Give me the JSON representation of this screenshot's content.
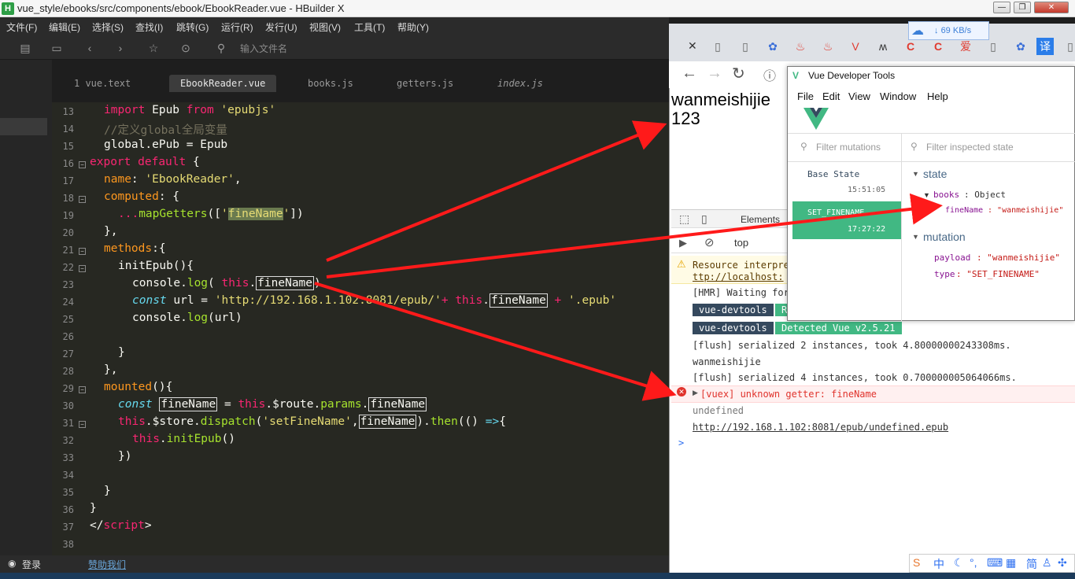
{
  "window": {
    "title": "vue_style/ebooks/src/components/ebook/EbookReader.vue - HBuilder X",
    "app_icon": "H"
  },
  "menu": [
    "文件(F)",
    "编辑(E)",
    "选择(S)",
    "查找(I)",
    "跳转(G)",
    "运行(R)",
    "发行(U)",
    "视图(V)",
    "工具(T)",
    "帮助(Y)"
  ],
  "toolbar": {
    "path_placeholder": "输入文件名"
  },
  "tabs": [
    "1 vue.text",
    "EbookReader.vue",
    "books.js",
    "getters.js",
    "index.js"
  ],
  "code": {
    "line_numbers": [
      "13",
      "14",
      "15",
      "16",
      "17",
      "18",
      "19",
      "20",
      "21",
      "22",
      "23",
      "24",
      "25",
      "26",
      "27",
      "28",
      "29",
      "30",
      "31",
      "32",
      "33",
      "34",
      "35",
      "36",
      "37",
      "38"
    ],
    "l13": [
      "import",
      " Epub ",
      "from",
      " 'epubjs'"
    ],
    "l14": "//定义global全局变量",
    "l15": [
      "global",
      ".ePub = Epub"
    ],
    "l16": [
      "export",
      " ",
      "default",
      " {"
    ],
    "l17": [
      "name",
      ": ",
      "'EbookReader'",
      ","
    ],
    "l18": [
      "computed",
      ": {"
    ],
    "l19": [
      "...",
      "mapGetters",
      "([",
      "'",
      "fineName",
      "'",
      "])"
    ],
    "l20": "},",
    "l21": [
      "methods",
      ":{"
    ],
    "l22": [
      "initEpub",
      "(){"
    ],
    "l23": [
      "console",
      ".",
      "log",
      "( ",
      "this",
      ".",
      "fineName",
      ")"
    ],
    "l24": [
      "const",
      " url = ",
      "'http://192.168.1.102:8081/epub/'",
      "+ ",
      "this",
      ".",
      "fineName",
      " + ",
      "'.epub'"
    ],
    "l25": [
      "console",
      ".",
      "log",
      "(url)"
    ],
    "l27": "}",
    "l28": "},",
    "l29": [
      "mounted",
      "(){"
    ],
    "l30": [
      "const",
      " ",
      "fineName",
      " = ",
      "this",
      ".$route.",
      "params",
      ".",
      "fineName"
    ],
    "l31": [
      "this",
      ".$store.",
      "dispatch",
      "(",
      "'setFineName'",
      ",",
      "fineName",
      ").",
      "then",
      "(() ",
      "=>",
      "{"
    ],
    "l32": [
      "this",
      ".",
      "initEpub",
      "()"
    ],
    "l33": "})",
    "l35": "}",
    "l36": "}",
    "l37": [
      "</",
      "script",
      ">"
    ]
  },
  "status": {
    "login": "登录",
    "sponsor": "赞助我们"
  },
  "speed": "69 KB/s",
  "browser": {
    "page_text_1": "wanmeishijie",
    "page_text_2": "123",
    "elements_tab": "Elements",
    "context": "top"
  },
  "console": {
    "warn_1": "Resource interpre",
    "warn_2": "ttp://localhost:",
    "hmr": "[HMR] Waiting for",
    "badge1": "vue-devtools",
    "badge1_tail": "R",
    "badge2": "vue-devtools",
    "badge2_tail": "Detected Vue v2.5.21",
    "flush1": "[flush] serialized 2 instances, took 4.80000000243308ms.",
    "log1": "wanmeishijie",
    "flush2": "[flush] serialized 4 instances, took 0.700000005064066ms.",
    "error": "[vuex] unknown getter: fineName",
    "undef": "undefined",
    "link": "http://192.168.1.102:8081/epub/undefined.epub",
    "prompt": ">"
  },
  "vue_devtools": {
    "title": "Vue Developer Tools",
    "menu": [
      "File",
      "Edit",
      "View",
      "Window",
      "Help"
    ],
    "filter_mutations": "Filter mutations",
    "filter_state": "Filter inspected state",
    "base_state": "Base State",
    "base_time": "15:51:05",
    "mutation_name": "SET_FINENAME",
    "mutation_time": "17:27:22",
    "state_label": "state",
    "books_key": "books",
    "books_val": "Object",
    "finename_key": "fineName",
    "finename_val": "\"wanmeishijie\"",
    "mutation_label": "mutation",
    "payload_key": "payload",
    "payload_val": "\"wanmeishijie\"",
    "type_key": "type",
    "type_val": "\"SET_FINENAME\""
  },
  "ime": [
    "中",
    "简"
  ],
  "colors": {
    "accent_green": "#41b883",
    "arrow_red": "#ff1a1a",
    "editor_bg": "#272822"
  }
}
